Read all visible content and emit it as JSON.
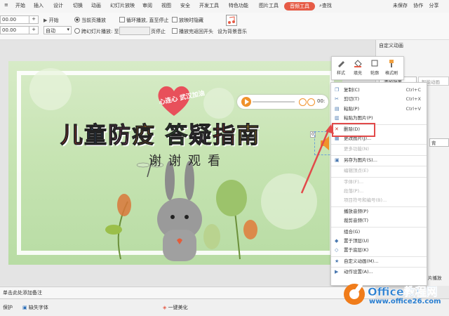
{
  "menubar": {
    "items": [
      "开始",
      "插入",
      "设计",
      "切换",
      "动画",
      "幻灯片放映",
      "审阅",
      "视图",
      "安全",
      "开发工具",
      "特色功能",
      "图片工具"
    ],
    "active_tab": "音频工具",
    "search": "查找",
    "sync": "未保存",
    "collab": "协作",
    "share": "分享"
  },
  "toolbar": {
    "volume_value": "00.00",
    "fade_value": "00.00",
    "start_label": "开始",
    "start_mode": "自动",
    "current_page_play": "当前页播放",
    "cross_slide_play": "跨幻灯片播放: 至",
    "page_stop": "页停止",
    "loop_label": "循环播放, 直至停止",
    "hide_label": "放映时隐藏",
    "rewind_label": "播放完返回开头",
    "bg_music": "设为背景音乐"
  },
  "slide": {
    "heart_text": "心连心 武汉加油",
    "title_chars": [
      {
        "ch": "儿",
        "color": "#e6332a"
      },
      {
        "ch": "童",
        "color": "#2c6fb8"
      },
      {
        "ch": "防",
        "color": "#d94f9b"
      },
      {
        "ch": "疫",
        "color": "#f08a1c"
      },
      {
        "ch": " ",
        "color": "#000000"
      },
      {
        "ch": "答",
        "color": "#3aa63a"
      },
      {
        "ch": "疑",
        "color": "#a25fc6"
      },
      {
        "ch": "指",
        "color": "#e6332a"
      },
      {
        "ch": "南",
        "color": "#f0b21c"
      }
    ],
    "subtitle": "谢谢观看",
    "player_time": "00:",
    "audio_index": "0"
  },
  "float_toolbar": {
    "items": [
      "样式",
      "填充",
      "轮廓",
      "格式刷"
    ]
  },
  "right_panel": {
    "title": "自定义动画",
    "add_effect": "添加效果",
    "smart_anim": "智能动画",
    "item": "背",
    "play": "片播放"
  },
  "context_menu": {
    "items": [
      {
        "label": "复制(C)",
        "shortcut": "Ctrl+C",
        "icon": "copy-icon",
        "disabled": false
      },
      {
        "label": "剪切(T)",
        "shortcut": "Ctrl+X",
        "icon": "cut-icon",
        "disabled": false
      },
      {
        "label": "粘贴(P)",
        "shortcut": "Ctrl+V",
        "icon": "paste-icon",
        "disabled": false
      },
      {
        "label": "粘贴为图片(P)",
        "shortcut": "",
        "icon": "paste-image-icon",
        "disabled": false
      },
      {
        "label": "删除(D)",
        "shortcut": "",
        "icon": "delete-icon",
        "disabled": false
      },
      {
        "label": "更改图片(J)...",
        "shortcut": "",
        "icon": "change-image-icon",
        "disabled": false
      },
      {
        "label": "更多功能(N)",
        "shortcut": "",
        "icon": "",
        "disabled": true
      },
      {
        "label": "另存为图片(S)...",
        "shortcut": "",
        "icon": "save-image-icon",
        "disabled": false
      },
      {
        "label": "编辑顶点(E)",
        "shortcut": "",
        "icon": "",
        "disabled": true
      },
      {
        "label": "字体(F)...",
        "shortcut": "",
        "icon": "",
        "disabled": true
      },
      {
        "label": "段落(P)...",
        "shortcut": "",
        "icon": "",
        "disabled": true
      },
      {
        "label": "项目符号和编号(B)...",
        "shortcut": "",
        "icon": "",
        "disabled": true
      },
      {
        "label": "播放音频(P)",
        "shortcut": "",
        "icon": "",
        "disabled": false
      },
      {
        "label": "裁剪音频(T)",
        "shortcut": "",
        "icon": "",
        "disabled": false
      },
      {
        "label": "组合(G)",
        "shortcut": "",
        "icon": "",
        "disabled": false
      },
      {
        "label": "置于顶层(U)",
        "shortcut": "",
        "icon": "bring-front-icon",
        "disabled": false
      },
      {
        "label": "置于底层(K)",
        "shortcut": "",
        "icon": "send-back-icon",
        "disabled": false
      },
      {
        "label": "自定义动画(M)...",
        "shortcut": "",
        "icon": "animation-icon",
        "disabled": false
      },
      {
        "label": "动作设置(A)...",
        "shortcut": "",
        "icon": "action-icon",
        "disabled": false
      }
    ]
  },
  "notes": "单击此处添加备注",
  "status": {
    "protect": "保护",
    "missing_font": "缺失字体",
    "beautify": "一键美化"
  },
  "watermark": {
    "title": "Office教程网",
    "url": "www.office26.com"
  },
  "colors": {
    "accent": "#e65b46",
    "highlight": "#e24a4a",
    "brand": "#f07c1a"
  }
}
